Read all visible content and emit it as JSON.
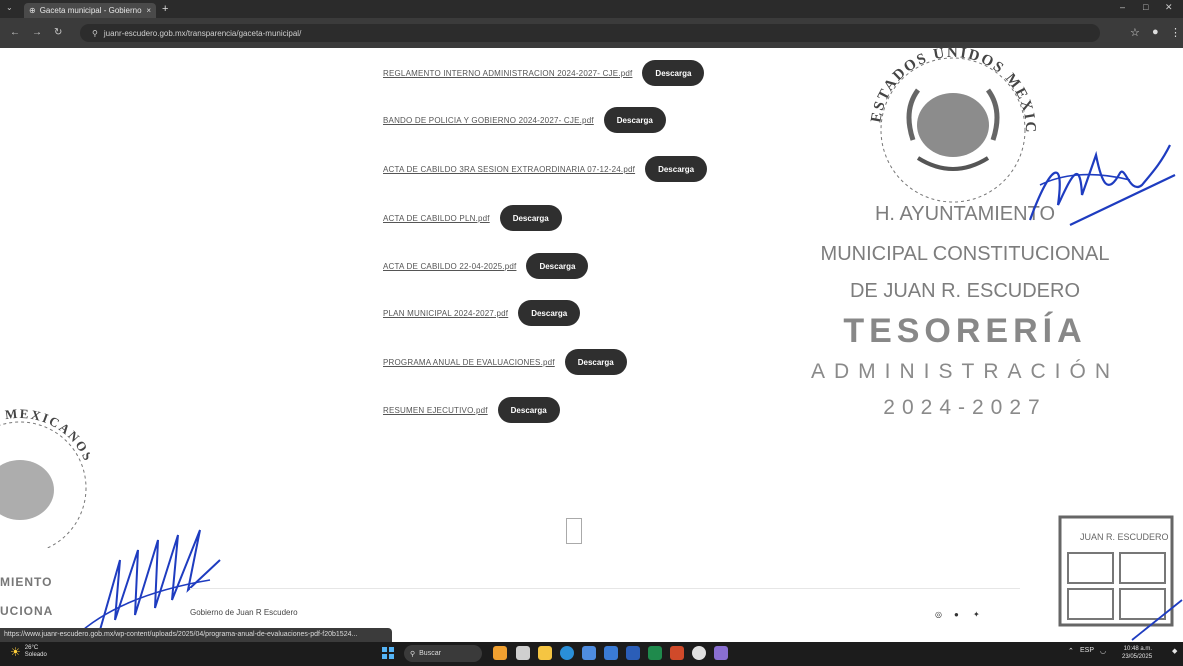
{
  "browser": {
    "tab_title": "Gaceta municipal - Gobierno d",
    "new_tab": "+",
    "url": "juanr-escudero.gob.mx/transparencia/gaceta-municipal/"
  },
  "documents": [
    {
      "name": "REGLAMENTO INTERNO ADMINISTRACION 2024-2027- CJE.pdf",
      "button": "Descarga"
    },
    {
      "name": "BANDO DE POLICIA Y GOBIERNO 2024-2027- CJE.pdf",
      "button": "Descarga"
    },
    {
      "name": "ACTA DE CABILDO 3RA SESION EXTRAORDINARIA 07-12-24.pdf",
      "button": "Descarga"
    },
    {
      "name": "ACTA DE CABILDO PLN.pdf",
      "button": "Descarga"
    },
    {
      "name": "ACTA DE CABILDO 22-04-2025.pdf",
      "button": "Descarga"
    },
    {
      "name": "PLAN MUNICIPAL 2024-2027.pdf",
      "button": "Descarga"
    },
    {
      "name": "PROGRAMA ANUAL DE EVALUACIONES.pdf",
      "button": "Descarga"
    },
    {
      "name": "RESUMEN EJECUTIVO.pdf",
      "button": "Descarga"
    }
  ],
  "stamp": {
    "seal_text": "ESTADOS UNIDOS MEXICANOS",
    "line1": "H. AYUNTAMIENTO",
    "line2": "MUNICIPAL CONSTITUCIONAL",
    "line3": "DE JUAN R. ESCUDERO",
    "line4": "TESORERÍA",
    "line5": "ADMINISTRACIÓN",
    "line6": "2024-2027"
  },
  "left_stamp": {
    "seal_text": "DOS MEXICANOS",
    "frag1": "MIENTO",
    "frag2": "UCIONA"
  },
  "bottom_right_seal": {
    "text": "JUAN R. ESCUDERO"
  },
  "footer": {
    "text": "Gobierno de Juan R Escudero"
  },
  "status_bar": {
    "url": "https://www.juanr-escudero.gob.mx/wp-content/uploads/2025/04/programa-anual-de-evaluaciones-pdf-f20b1524..."
  },
  "taskbar": {
    "weather_temp": "26°C",
    "weather_desc": "Soleado",
    "search_label": "Buscar",
    "tray_lang": "ESP",
    "time": "10:48 a.m.",
    "date": "23/05/2025"
  }
}
